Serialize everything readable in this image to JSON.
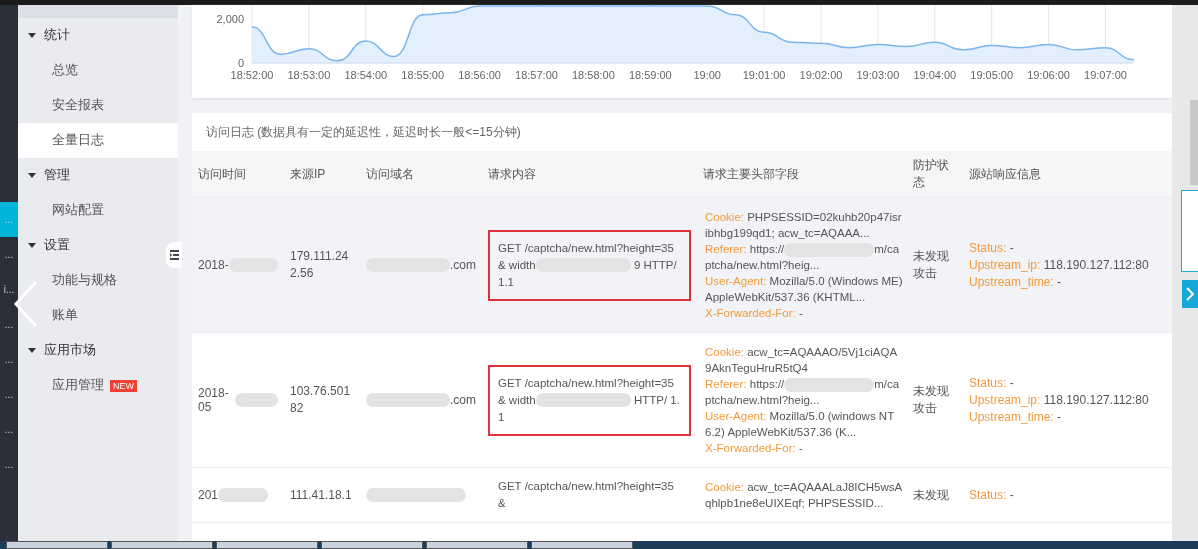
{
  "rail_items": [
    {
      "label": "...",
      "selected": true
    },
    {
      "label": "...",
      "selected": false
    },
    {
      "label": "i...",
      "selected": false
    },
    {
      "label": "...",
      "selected": false
    },
    {
      "label": "...",
      "selected": false
    },
    {
      "label": "...",
      "selected": false
    },
    {
      "label": "...",
      "selected": false
    },
    {
      "label": "...",
      "selected": false
    }
  ],
  "sidebar": {
    "groups": [
      {
        "label": "统计",
        "expanded": true,
        "items": [
          {
            "label": "总览",
            "selected": false
          },
          {
            "label": "安全报表",
            "selected": false
          },
          {
            "label": "全量日志",
            "selected": true
          }
        ]
      },
      {
        "label": "管理",
        "expanded": true,
        "items": [
          {
            "label": "网站配置",
            "selected": false
          }
        ]
      },
      {
        "label": "设置",
        "expanded": true,
        "items": [
          {
            "label": "功能与规格",
            "selected": false
          },
          {
            "label": "账单",
            "selected": false
          }
        ]
      },
      {
        "label": "应用市场",
        "expanded": true,
        "items": [
          {
            "label": "应用管理",
            "selected": false,
            "badge": "NEW"
          }
        ]
      }
    ]
  },
  "chart": {
    "chart_data": {
      "type": "area",
      "categories": [
        "18:52:00",
        null,
        "18:53:00",
        null,
        "18:54:00",
        null,
        "18:55:00",
        null,
        "18:56:00",
        null,
        "18:57:00",
        null,
        "18:58:00",
        null,
        "18:59:00",
        null,
        "19:00",
        null,
        "19:01:00",
        null,
        "19:02:00",
        null,
        "19:03:00",
        null,
        "19:04:00",
        null,
        "19:05:00",
        null,
        "19:06:00",
        null,
        "19:07:00",
        null
      ],
      "series": [
        {
          "color": "#7cb5ec",
          "values": [
            1650,
            400,
            650,
            100,
            1000,
            300,
            2200,
            2300,
            2600,
            2600,
            2600,
            2600,
            2600,
            2600,
            2600,
            2600,
            2600,
            2200,
            1400,
            950,
            900,
            700,
            850,
            750,
            950,
            600,
            800,
            700,
            850,
            600,
            700,
            150
          ]
        }
      ],
      "ylim": [
        0,
        2650
      ],
      "grid": true,
      "yticks": [
        {
          "value": 0,
          "label": "0"
        },
        {
          "value": 2000,
          "label": "2,000"
        }
      ]
    }
  },
  "log": {
    "title": "访问日志 (数据具有一定的延迟性，延迟时长一般<=15分钟)",
    "columns": [
      "访问时间",
      "来源IP",
      "访问域名",
      "请求内容",
      "请求主要头部字段",
      "防护状态",
      "源站响应信息"
    ],
    "rows": [
      {
        "highlighted": true,
        "time": "2018-",
        "ip": "179.111.242.56",
        "domain": ".com",
        "request": {
          "before": "GET /captcha/new.html?height=35& width",
          "after": "9 HTTP/ 1.1",
          "boxed": true
        },
        "headers": [
          {
            "key": "Cookie:",
            "value": "PHPSESSID=02kuhb20p47isribhbg199qd1; acw_tc=AQAAA..."
          },
          {
            "key": "Referer:",
            "value": "https://",
            "rest": "m/captcha/new.html?heig..."
          },
          {
            "key": "User-Agent:",
            "value": "Mozilla/5.0 (Windows ME) AppleWebKit/537.36 (KHTML..."
          },
          {
            "key": "X-Forwarded-For:",
            "value": "-"
          }
        ],
        "protection": "未发现攻击",
        "response": [
          {
            "key": "Status:",
            "value": "-"
          },
          {
            "key": "Upstream_ip:",
            "value": "118.190.127.112:80"
          },
          {
            "key": "Upstream_time:",
            "value": "-"
          }
        ]
      },
      {
        "highlighted": false,
        "time": "2018-05",
        "ip": "103.76.50182",
        "domain": ".com",
        "request": {
          "before": "GET /captcha/new.html?height=35& width",
          "after": "HTTP/ 1.1",
          "boxed": true
        },
        "headers": [
          {
            "key": "Cookie:",
            "value": "acw_tc=AQAAAO/5Vj1ciAQA9AknTeguHruR5tQ4"
          },
          {
            "key": "Referer:",
            "value": "https://",
            "rest": "m/captcha/new.html?heig..."
          },
          {
            "key": "User-Agent:",
            "value": "Mozilla/5.0 (windows NT 6.2) AppleWebKit/537.36 (K..."
          },
          {
            "key": "X-Forwarded-For:",
            "value": "-"
          }
        ],
        "protection": "未发现攻击",
        "response": [
          {
            "key": "Status:",
            "value": "-"
          },
          {
            "key": "Upstream_ip:",
            "value": "118.190.127.112:80"
          },
          {
            "key": "Upstream_time:",
            "value": "-"
          }
        ]
      },
      {
        "highlighted": false,
        "time": "201",
        "ip": "111.41.18.1",
        "request": {
          "before": "GET /captcha/new.html?height=35&",
          "boxed": false
        },
        "headers": [
          {
            "key": "Cookie:",
            "value": "acw_tc=AQAAALaJ8ICH5wsAqhlpb1ne8eUIXEqf; PHPSESSID..."
          }
        ],
        "protection": "未发现",
        "response": [
          {
            "key": "Status:",
            "value": "-"
          }
        ]
      }
    ]
  }
}
